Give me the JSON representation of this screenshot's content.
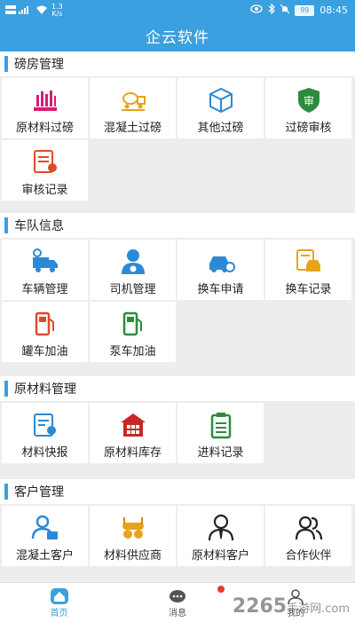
{
  "status_bar": {
    "net_speed": "1.3",
    "net_unit": "K/s",
    "battery": "99",
    "time": "08:45"
  },
  "app_title": "企云软件",
  "sections": [
    {
      "title": "磅房管理",
      "items": [
        {
          "label": "原材料过磅",
          "icon": "scale-icon"
        },
        {
          "label": "混凝土过磅",
          "icon": "mixer-truck-icon"
        },
        {
          "label": "其他过磅",
          "icon": "box-icon"
        },
        {
          "label": "过磅审核",
          "icon": "audit-shield-icon"
        },
        {
          "label": "审核记录",
          "icon": "audit-record-icon"
        }
      ]
    },
    {
      "title": "车队信息",
      "items": [
        {
          "label": "车辆管理",
          "icon": "truck-gear-icon"
        },
        {
          "label": "司机管理",
          "icon": "driver-icon"
        },
        {
          "label": "换车申请",
          "icon": "car-swap-icon"
        },
        {
          "label": "换车记录",
          "icon": "car-record-icon"
        },
        {
          "label": "罐车加油",
          "icon": "fuel-pump-red-icon"
        },
        {
          "label": "泵车加油",
          "icon": "fuel-pump-green-icon"
        }
      ]
    },
    {
      "title": "原材料管理",
      "items": [
        {
          "label": "材料快报",
          "icon": "material-report-icon"
        },
        {
          "label": "原材料库存",
          "icon": "warehouse-icon"
        },
        {
          "label": "进料记录",
          "icon": "clipboard-icon"
        }
      ]
    },
    {
      "title": "客户管理",
      "items": [
        {
          "label": "混凝土客户",
          "icon": "customer-card-icon"
        },
        {
          "label": "材料供应商",
          "icon": "supplier-icon"
        },
        {
          "label": "原材料客户",
          "icon": "client-tie-icon"
        },
        {
          "label": "合作伙伴",
          "icon": "partners-icon"
        }
      ]
    }
  ],
  "bottom_nav": [
    {
      "label": "首页",
      "icon": "home-icon",
      "active": true
    },
    {
      "label": "消息",
      "icon": "message-icon",
      "active": false
    },
    {
      "label": "我的",
      "icon": "profile-icon",
      "active": false
    }
  ],
  "watermark": {
    "brand": "2265",
    "suffix": "手游网",
    "domain": ".com"
  },
  "colors": {
    "primary": "#3aa0df",
    "background": "#ededed"
  }
}
